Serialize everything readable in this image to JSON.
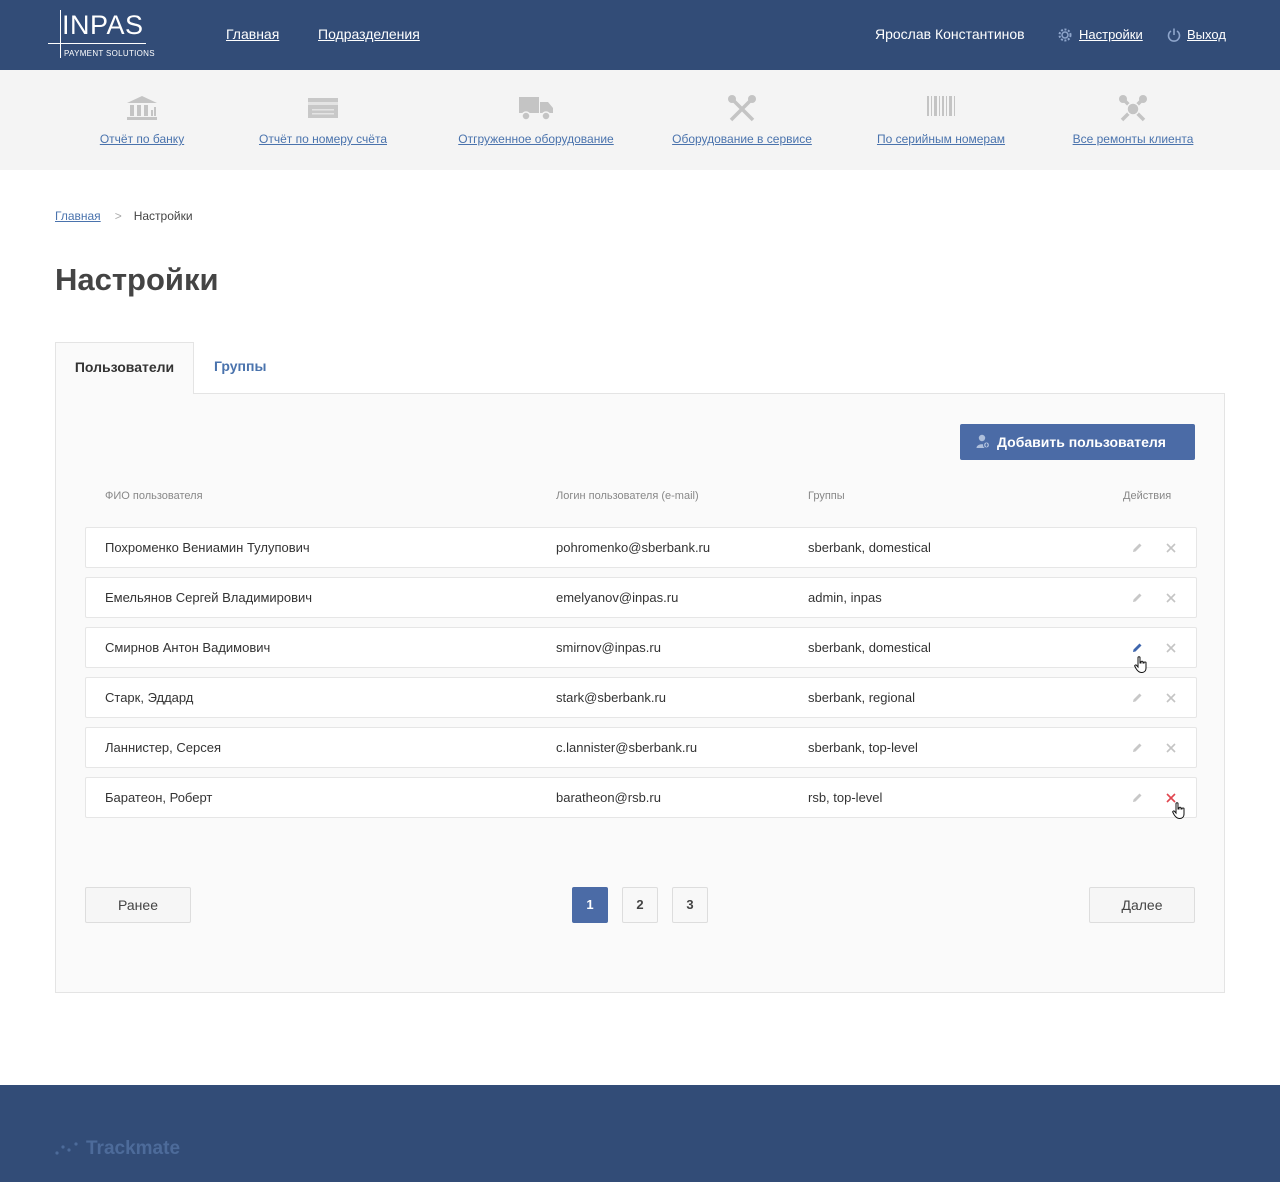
{
  "header": {
    "logo_text": "INPAS",
    "logo_tagline": "PAYMENT SOLUTIONS",
    "nav": [
      "Главная",
      "Подразделения"
    ],
    "user_name": "Ярослав Константинов",
    "settings_label": "Настройки",
    "logout_label": "Выход"
  },
  "quicknav": [
    {
      "label": "Отчёт по банку",
      "icon": "bank-icon"
    },
    {
      "label": "Отчёт по номеру счёта",
      "icon": "card-icon"
    },
    {
      "label": "Отгруженное оборудование",
      "icon": "truck-icon"
    },
    {
      "label": "Оборудование в сервисе",
      "icon": "tools-icon"
    },
    {
      "label": "По серийным номерам",
      "icon": "barcode-icon"
    },
    {
      "label": "Все ремонты клиента",
      "icon": "repair-icon"
    }
  ],
  "breadcrumb": {
    "home": "Главная",
    "separator": ">",
    "current": "Настройки"
  },
  "page_title": "Настройки",
  "tabs": [
    {
      "label": "Пользователи",
      "active": true
    },
    {
      "label": "Группы",
      "active": false
    }
  ],
  "add_user_label": "Добавить пользователя",
  "table": {
    "columns": [
      "ФИО пользователя",
      "Логин пользователя (e-mail)",
      "Группы",
      "Действия"
    ],
    "rows": [
      {
        "name": "Похроменко Вениамин Тулупович",
        "login": "pohromenko@sberbank.ru",
        "groups": "sberbank, domestical"
      },
      {
        "name": "Емельянов Сергей Владимирович",
        "login": "emelyanov@inpas.ru",
        "groups": "admin, inpas"
      },
      {
        "name": "Смирнов Антон Вадимович",
        "login": "smirnov@inpas.ru",
        "groups": "sberbank, domestical"
      },
      {
        "name": "Старк, Эддард",
        "login": "stark@sberbank.ru",
        "groups": "sberbank, regional"
      },
      {
        "name": "Ланнистер, Серсея",
        "login": "c.lannister@sberbank.ru",
        "groups": "sberbank, top-level"
      },
      {
        "name": "Баратеон, Роберт",
        "login": "baratheon@rsb.ru",
        "groups": "rsb, top-level"
      }
    ]
  },
  "pagination": {
    "prev": "Ранее",
    "next": "Далее",
    "pages": [
      "1",
      "2",
      "3"
    ],
    "current": "1"
  },
  "footer": {
    "logo_text": "Trackmate"
  },
  "colors": {
    "header_bg": "#324c77",
    "accent": "#4b6ba6",
    "link": "#4a73ad",
    "delete_hover": "#e0464f"
  }
}
